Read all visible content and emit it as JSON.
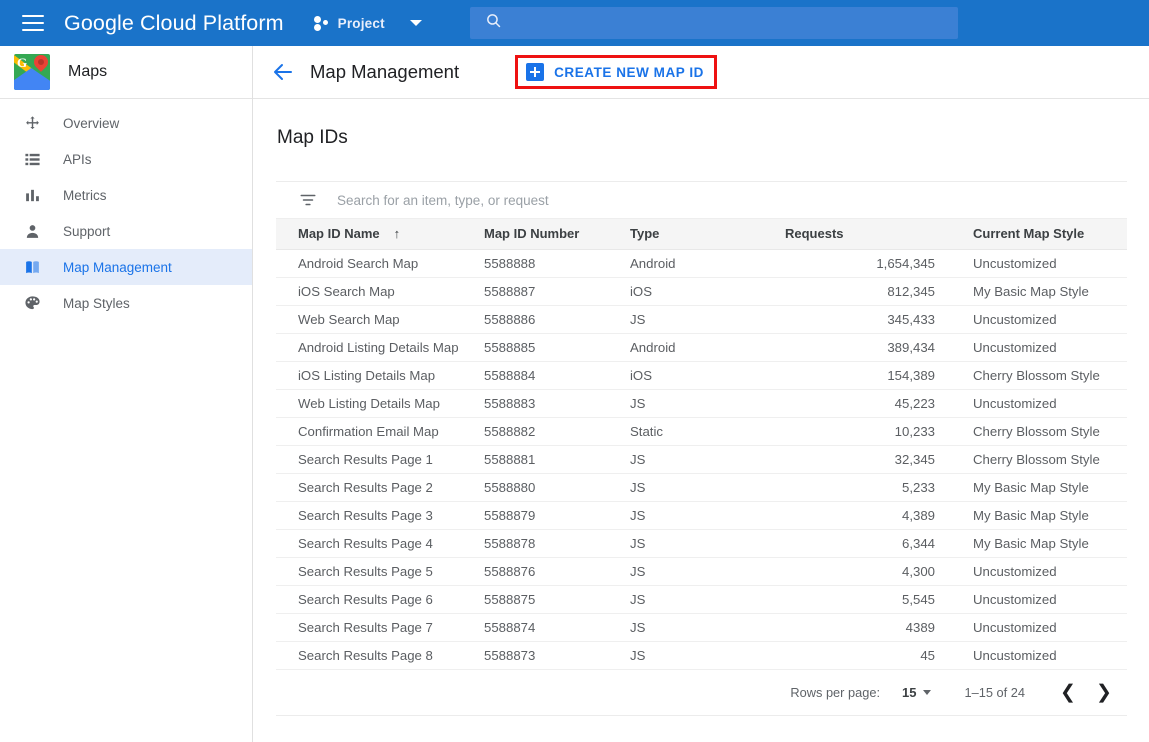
{
  "topbar": {
    "menu_icon": "hamburger-icon",
    "brand_primary": "Google",
    "brand_secondary": " Cloud Platform",
    "project_label": "Project",
    "project_icon": "project-dots-icon",
    "caret_icon": "chevron-down-icon",
    "search_icon": "search-icon",
    "search_value": "",
    "search_placeholder": "",
    "bar_color": "#1a73c9",
    "search_bg": "#3b80d4"
  },
  "sidebar": {
    "product_icon": "google-maps-icon",
    "product_title": "Maps",
    "items": [
      {
        "label": "Overview",
        "icon": "move-arrows-icon",
        "active": false
      },
      {
        "label": "APIs",
        "icon": "list-icon",
        "active": false
      },
      {
        "label": "Metrics",
        "icon": "bar-chart-icon",
        "active": false
      },
      {
        "label": "Support",
        "icon": "person-icon",
        "active": false
      },
      {
        "label": "Map Management",
        "icon": "map-icon",
        "active": true
      },
      {
        "label": "Map Styles",
        "icon": "palette-icon",
        "active": false
      }
    ],
    "active_color": "#1a73e8",
    "active_bg": "#e4ecfa"
  },
  "page": {
    "back_icon": "back-arrow-icon",
    "title": "Map Management",
    "create_button_label": "CREATE NEW MAP ID",
    "create_button_icon": "plus-square-icon",
    "highlight_color": "#ee1111",
    "section_title": "Map IDs"
  },
  "search": {
    "icon": "filter-icon",
    "placeholder": "Search for an item, type, or request",
    "value": ""
  },
  "table": {
    "columns": [
      {
        "label": "Map ID Name",
        "sorted": true,
        "sort_icon": "arrow-up-icon"
      },
      {
        "label": "Map ID Number",
        "sorted": false
      },
      {
        "label": "Type",
        "sorted": false
      },
      {
        "label": "Requests",
        "sorted": false
      },
      {
        "label": "Current Map Style",
        "sorted": false
      }
    ],
    "sort_arrow": "↑",
    "rows": [
      {
        "name": "Android Search Map",
        "number": "5588888",
        "type": "Android",
        "requests": "1,654,345",
        "style": "Uncustomized"
      },
      {
        "name": "iOS Search Map",
        "number": "5588887",
        "type": "iOS",
        "requests": "812,345",
        "style": "My Basic Map Style"
      },
      {
        "name": "Web Search Map",
        "number": "5588886",
        "type": "JS",
        "requests": "345,433",
        "style": "Uncustomized"
      },
      {
        "name": "Android Listing Details Map",
        "number": "5588885",
        "type": "Android",
        "requests": "389,434",
        "style": "Uncustomized"
      },
      {
        "name": "iOS Listing Details Map",
        "number": "5588884",
        "type": "iOS",
        "requests": "154,389",
        "style": "Cherry Blossom Style"
      },
      {
        "name": "Web Listing Details Map",
        "number": "5588883",
        "type": "JS",
        "requests": "45,223",
        "style": "Uncustomized"
      },
      {
        "name": "Confirmation Email Map",
        "number": "5588882",
        "type": "Static",
        "requests": "10,233",
        "style": "Cherry Blossom Style"
      },
      {
        "name": "Search Results Page 1",
        "number": "5588881",
        "type": "JS",
        "requests": "32,345",
        "style": "Cherry Blossom Style"
      },
      {
        "name": "Search Results Page 2",
        "number": "5588880",
        "type": "JS",
        "requests": "5,233",
        "style": "My Basic Map Style"
      },
      {
        "name": "Search Results Page 3",
        "number": "5588879",
        "type": "JS",
        "requests": "4,389",
        "style": "My Basic Map Style"
      },
      {
        "name": "Search Results Page 4",
        "number": "5588878",
        "type": "JS",
        "requests": "6,344",
        "style": "My Basic Map Style"
      },
      {
        "name": "Search Results Page 5",
        "number": "5588876",
        "type": "JS",
        "requests": "4,300",
        "style": "Uncustomized"
      },
      {
        "name": "Search Results Page 6",
        "number": "5588875",
        "type": "JS",
        "requests": "5,545",
        "style": "Uncustomized"
      },
      {
        "name": "Search Results Page 7",
        "number": "5588874",
        "type": "JS",
        "requests": "4389",
        "style": "Uncustomized"
      },
      {
        "name": "Search Results Page 8",
        "number": "5588873",
        "type": "JS",
        "requests": "45",
        "style": "Uncustomized"
      }
    ]
  },
  "pagination": {
    "rows_per_page_label": "Rows per page:",
    "rows_per_page_value": "15",
    "range_label": "1–15 of 24",
    "prev_icon": "chevron-left-icon",
    "prev_glyph": "❮",
    "next_icon": "chevron-right-icon",
    "next_glyph": "❯"
  }
}
